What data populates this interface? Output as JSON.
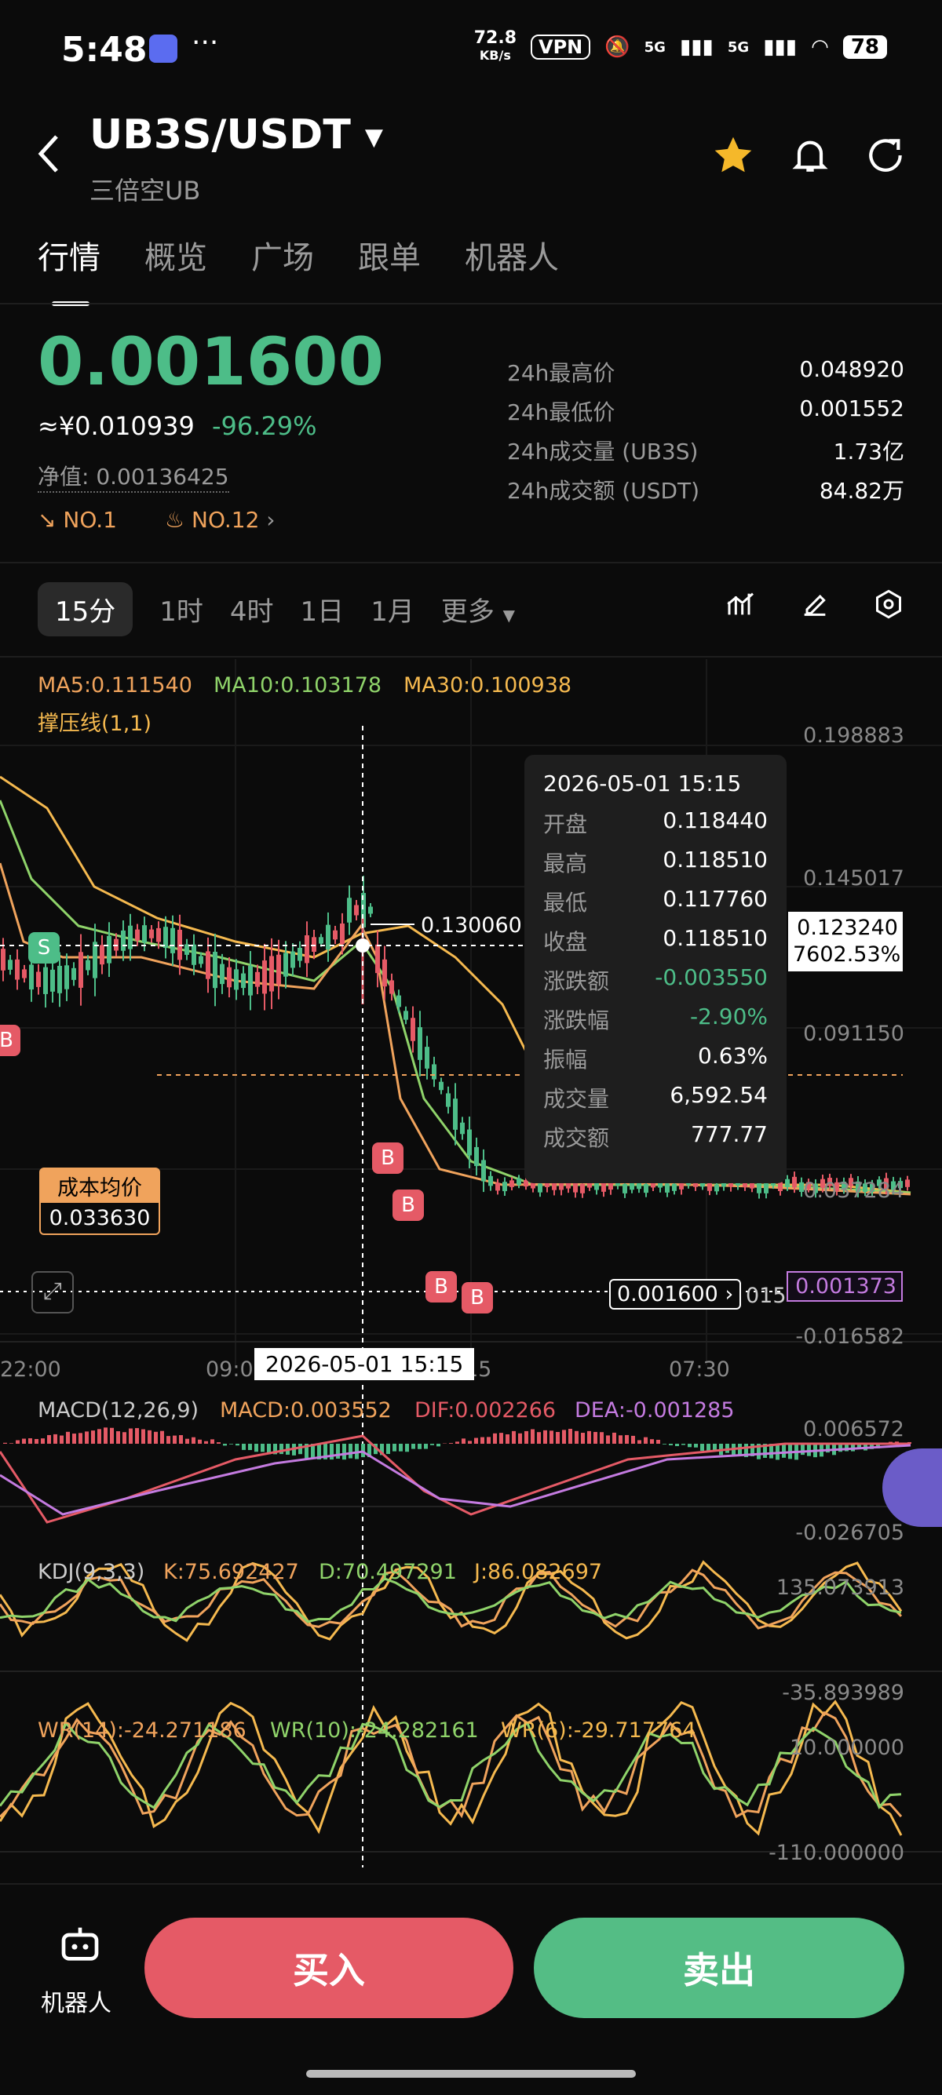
{
  "status": {
    "time": "5:48",
    "net_speed": "72.8",
    "net_unit": "KB/s",
    "vpn": "VPN",
    "sig1": "5G",
    "sig2": "5G",
    "battery": "78"
  },
  "header": {
    "pair": "UB3S/USDT",
    "subtitle": "三倍空UB"
  },
  "tabs": [
    "行情",
    "概览",
    "广场",
    "跟单",
    "机器人"
  ],
  "ticker": {
    "price": "0.001600",
    "cny": "≈¥0.010939",
    "change": "-96.29%",
    "nav": "净值: 0.00136425",
    "rank1": "NO.1",
    "rank2": "NO.12",
    "stats": [
      {
        "k": "24h最高价",
        "v": "0.048920"
      },
      {
        "k": "24h最低价",
        "v": "0.001552"
      },
      {
        "k": "24h成交量 (UB3S)",
        "v": "1.73亿"
      },
      {
        "k": "24h成交额 (USDT)",
        "v": "84.82万"
      }
    ]
  },
  "intervals": [
    "15分",
    "1时",
    "4时",
    "1日",
    "1月",
    "更多"
  ],
  "indicators": {
    "ma5": "MA5:0.111540",
    "ma10": "MA10:0.103178",
    "ma30": "MA30:0.100938",
    "support": "撑压线(1,1)",
    "macd_title": "MACD(12,26,9)",
    "macd": "MACD:0.003552",
    "dif": "DIF:0.002266",
    "dea": "DEA:-0.001285",
    "kdj_title": "KDJ(9,3,3)",
    "k": "K:75.692427",
    "d": "D:70.497291",
    "j": "J:86.082697",
    "wr14": "WR(14):-24.271186",
    "wr10": "WR(10):-24.282161",
    "wr6": "WR(6):-29.717764"
  },
  "axis": {
    "main": [
      "0.198883",
      "0.145017",
      "0.091150",
      "0.037284",
      "-0.016582"
    ],
    "macd": [
      "0.006572",
      "-0.026705"
    ],
    "kdj": [
      "135.073913",
      "-35.893989"
    ],
    "wr": [
      "10.000000",
      "-110.000000"
    ],
    "time": [
      "22:00",
      "09:00",
      "15",
      "07:30"
    ]
  },
  "chart_labels": {
    "high_marker": "0.130060",
    "cursor_price": "0.123240",
    "cursor_pct": "7602.53%",
    "cost_title": "成本均价",
    "cost_value": "0.033630",
    "last_price": "0.001600",
    "last_price_tail": "015",
    "purple_price": "0.001373",
    "cursor_time": "2026-05-01 15:15",
    "s_tag": "S",
    "b_tag": "B"
  },
  "tooltip": {
    "date": "2026-05-01 15:15",
    "rows": [
      {
        "k": "开盘",
        "v": "0.118440",
        "c": "#ffffff"
      },
      {
        "k": "最高",
        "v": "0.118510",
        "c": "#ffffff"
      },
      {
        "k": "最低",
        "v": "0.117760",
        "c": "#ffffff"
      },
      {
        "k": "收盘",
        "v": "0.118510",
        "c": "#ffffff"
      },
      {
        "k": "涨跌额",
        "v": "-0.003550",
        "c": "#4dbd88"
      },
      {
        "k": "涨跌幅",
        "v": "-2.90%",
        "c": "#4dbd88"
      },
      {
        "k": "振幅",
        "v": "0.63%",
        "c": "#ffffff"
      },
      {
        "k": "成交量",
        "v": "6,592.54",
        "c": "#ffffff"
      },
      {
        "k": "成交额",
        "v": "777.77",
        "c": "#ffffff"
      }
    ]
  },
  "bottom": {
    "robot": "机器人",
    "buy": "买入",
    "sell": "卖出"
  },
  "colors": {
    "up": "#e55a66",
    "down": "#4dbd88",
    "ma5": "#f0a35c",
    "ma10": "#8fd36a",
    "ma30": "#f5b94f",
    "dea": "#c47be0"
  }
}
